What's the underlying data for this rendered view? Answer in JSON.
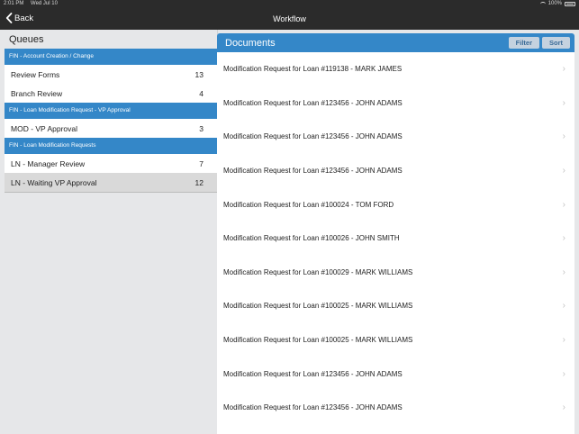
{
  "status_bar": {
    "time": "2:01 PM",
    "date": "Wed Jul 10",
    "battery": "100%"
  },
  "nav": {
    "back_label": "Back",
    "title": "Workflow"
  },
  "queues": {
    "title": "Queues",
    "groups": [
      {
        "name": "FIN - Account Creation / Change",
        "items": [
          {
            "label": "Review Forms",
            "count": "13"
          },
          {
            "label": "Branch Review",
            "count": "4"
          }
        ]
      },
      {
        "name": "FIN - Loan Modification Request - VP Approval",
        "items": [
          {
            "label": "MOD - VP Approval",
            "count": "3"
          }
        ]
      },
      {
        "name": "FIN - Loan Modification Requests",
        "items": [
          {
            "label": "LN - Manager Review",
            "count": "7"
          },
          {
            "label": "LN - Waiting VP Approval",
            "count": "12",
            "selected": true
          }
        ]
      }
    ]
  },
  "documents": {
    "title": "Documents",
    "filter_label": "Filter",
    "sort_label": "Sort",
    "items": [
      "Modification Request for Loan #119138 - MARK JAMES",
      "Modification Request for Loan #123456 - JOHN ADAMS",
      "Modification Request for Loan #123456 - JOHN ADAMS",
      "Modification Request for Loan #123456 - JOHN ADAMS",
      "Modification Request for Loan #100024 - TOM FORD",
      "Modification Request for Loan #100026 - JOHN SMITH",
      "Modification Request for Loan #100029 - MARK WILLIAMS",
      "Modification Request for Loan #100025 - MARK WILLIAMS",
      "Modification Request for Loan #100025 - MARK WILLIAMS",
      "Modification Request for Loan #123456 - JOHN ADAMS",
      "Modification Request for Loan #123456 - JOHN ADAMS"
    ]
  },
  "icons": {
    "back": "chevron-left-icon",
    "row_disclosure": "chevron-right-icon",
    "wifi": "wifi-icon",
    "battery": "battery-icon"
  },
  "colors": {
    "accent": "#3487c8",
    "navbar": "#2b2b2b",
    "selected_row": "#d9d9d9"
  }
}
